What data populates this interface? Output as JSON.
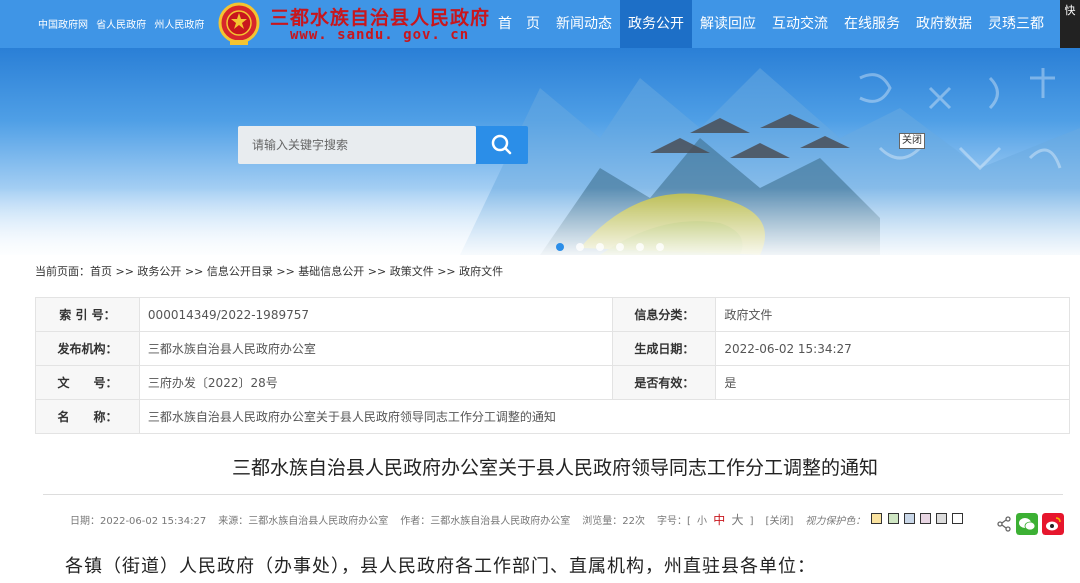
{
  "header": {
    "top_links": [
      "中国政府网",
      "省人民政府",
      "州人民政府"
    ],
    "site_title": "三都水族自治县人民政府",
    "site_url": "www. sandu. gov. cn",
    "nav": [
      "首　页",
      "新闻动态",
      "政务公开",
      "解读回应",
      "互动交流",
      "在线服务",
      "政府数据",
      "灵琇三都"
    ],
    "active_nav": "政务公开",
    "quick_label": "快"
  },
  "banner": {
    "search_placeholder": "请输入关键字搜索",
    "close_label": "关闭",
    "slide_count": 6,
    "active_slide": 0
  },
  "breadcrumb": "当前页面：首页 >> 政务公开 >> 信息公开目录 >> 基础信息公开 >> 政策文件 >> 政府文件",
  "info": {
    "index_label": "索 引 号：",
    "index_value": "000014349/2022-1989757",
    "category_label": "信息分类：",
    "category_value": "政府文件",
    "publisher_label": "发布机构：",
    "publisher_value": "三都水族自治县人民政府办公室",
    "date_label": "生成日期：",
    "date_value": "2022-06-02 15:34:27",
    "docno_label": "文　　号：",
    "docno_value": "三府办发〔2022〕28号",
    "valid_label": "是否有效：",
    "valid_value": "是",
    "name_label": "名　　称：",
    "name_value": "三都水族自治县人民政府办公室关于县人民政府领导同志工作分工调整的通知"
  },
  "article": {
    "title": "三都水族自治县人民政府办公室关于县人民政府领导同志工作分工调整的通知",
    "meta_date": "日期：2022-06-02 15:34:27",
    "meta_source": "来源：三都水族自治县人民政府办公室",
    "meta_author": "作者：三都水族自治县人民政府办公室",
    "meta_views": "浏览量：22次",
    "font_label": "字号：[",
    "font_small": "小",
    "font_medium": "中",
    "font_large": "大",
    "font_end": "]",
    "close_link": "[关闭]",
    "vision_label": "视力保护色：",
    "vision_colors": [
      "#fae3a0",
      "#cfe6c3",
      "#c9d7e8",
      "#e8d6e3",
      "#dcdcdc",
      "#ffffff"
    ],
    "body_first_line": "各镇（街道）人民政府（办事处），县人民政府各工作部门、直属机构，州直驻县各单位："
  },
  "colors": {
    "header_bg": "#3f95e6",
    "nav_active": "#1d6fc7",
    "title_red": "#c8161d",
    "wechat": "#3cb034",
    "weibo": "#e6162d"
  }
}
